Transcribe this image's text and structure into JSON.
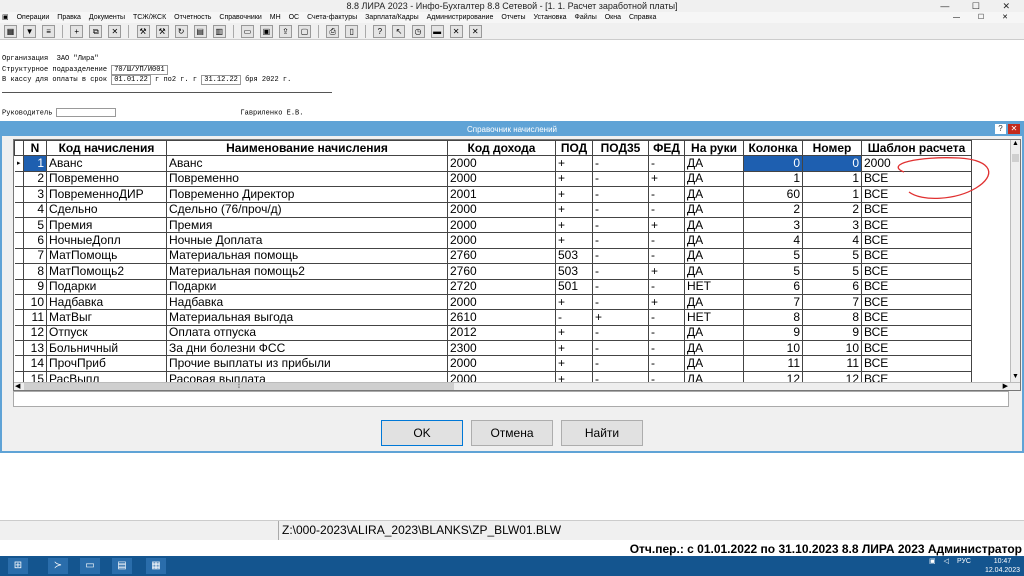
{
  "window": {
    "title": "8.8 ЛИРА 2023 - Инфо-Бухгалтер 8.8 Сетевой - [1. 1. Расчет заработной платы]",
    "controls": "— ☐ ✕"
  },
  "menu": {
    "items": [
      "Операции",
      "Правка",
      "Документы",
      "ТСЖ/ЖСК",
      "Отчетность",
      "Справочники",
      "МН",
      "ОС",
      "Счета-фактуры",
      "Зарплата/Кадры",
      "Администрирование",
      "Отчеты",
      "Установка",
      "Файлы",
      "Окна",
      "Справка"
    ],
    "controls": "— ☐ ✕"
  },
  "doc": {
    "org_label": "Организация",
    "org_value": "ЗАО \"Лира\"",
    "dept_label": "Структурное подразделение",
    "dept_value": "70/Ш/УП/И001",
    "cash_label": "В кассу для оплаты в срок",
    "date_from": "01.01.22",
    "mid_text": "г по2 г. г",
    "date_to": "31.12.22",
    "tail_text": "бря 2022 г.",
    "head_label": "Руководитель",
    "head_value": "Гавриленко Е.В."
  },
  "dialog": {
    "title": "Справочник начислений",
    "help": "?",
    "close": "✕"
  },
  "table": {
    "columns": [
      "N",
      "Код начисления",
      "Наименование начисления",
      "Код дохода",
      "ПОД",
      "ПОД35",
      "ФЕД",
      "На руки",
      "Колонка",
      "Номер",
      "Шаблон расчета"
    ],
    "rows": [
      [
        "1",
        "Аванс",
        "Аванс",
        "2000",
        "+",
        "-",
        "-",
        "ДА",
        "0",
        "0",
        "2000"
      ],
      [
        "2",
        "Повременно",
        "Повременно",
        "2000",
        "+",
        "-",
        "+",
        "ДА",
        "1",
        "1",
        "ВСЕ"
      ],
      [
        "3",
        "ПовременноДИР",
        "Повременно Директор",
        "2001",
        "+",
        "-",
        "-",
        "ДА",
        "60",
        "1",
        "ВСЕ"
      ],
      [
        "4",
        "Сдельно",
        "Сдельно (76/проч/д)",
        "2000",
        "+",
        "-",
        "-",
        "ДА",
        "2",
        "2",
        "ВСЕ"
      ],
      [
        "5",
        "Премия",
        "Премия",
        "2000",
        "+",
        "-",
        "+",
        "ДА",
        "3",
        "3",
        "ВСЕ"
      ],
      [
        "6",
        "НочныеДопл",
        "Ночные Доплата",
        "2000",
        "+",
        "-",
        "-",
        "ДА",
        "4",
        "4",
        "ВСЕ"
      ],
      [
        "7",
        "МатПомощь",
        "Материальная помощь",
        "2760",
        "503",
        "-",
        "-",
        "ДА",
        "5",
        "5",
        "ВСЕ"
      ],
      [
        "8",
        "МатПомощь2",
        "Материальная помощь2",
        "2760",
        "503",
        "-",
        "+",
        "ДА",
        "5",
        "5",
        "ВСЕ"
      ],
      [
        "9",
        "Подарки",
        "Подарки",
        "2720",
        "501",
        "-",
        "-",
        "НЕТ",
        "6",
        "6",
        "ВСЕ"
      ],
      [
        "10",
        "Надбавка",
        "Надбавка",
        "2000",
        "+",
        "-",
        "+",
        "ДА",
        "7",
        "7",
        "ВСЕ"
      ],
      [
        "11",
        "МатВыг",
        "Материальная выгода",
        "2610",
        "-",
        "+",
        "-",
        "НЕТ",
        "8",
        "8",
        "ВСЕ"
      ],
      [
        "12",
        "Отпуск",
        "Оплата отпуска",
        "2012",
        "+",
        "-",
        "-",
        "ДА",
        "9",
        "9",
        "ВСЕ"
      ],
      [
        "13",
        "Больничный",
        "За дни болезни    ФСС",
        "2300",
        "+",
        "-",
        "-",
        "ДА",
        "10",
        "10",
        "ВСЕ"
      ],
      [
        "14",
        "ПрочПриб",
        "Прочие выплаты из прибыли",
        "2000",
        "+",
        "-",
        "-",
        "ДА",
        "11",
        "11",
        "ВСЕ"
      ],
      [
        "15",
        "РасВыпл",
        "Расовая выплата",
        "2000",
        "+",
        "-",
        "-",
        "ДА",
        "12",
        "12",
        "ВСЕ"
      ]
    ],
    "selected_row": 0
  },
  "buttons": {
    "ok": "OK",
    "cancel": "Отмена",
    "find": "Найти"
  },
  "status": {
    "path": "Z:\\000-2023\\ALIRA_2023\\BLANKS\\ZP_BLW01.BLW",
    "period": "Отч.пер.: с 01.01.2022 по 31.10.2023 8.8 ЛИРА 2023  Администратор"
  },
  "taskbar": {
    "lang": "РУС",
    "time": "10:47",
    "date": "12.04.2023"
  },
  "colors": {
    "accent": "#5fa3d6",
    "selection": "#1e5fb0",
    "taskbar": "#14558f",
    "annotation": "#e03030"
  }
}
